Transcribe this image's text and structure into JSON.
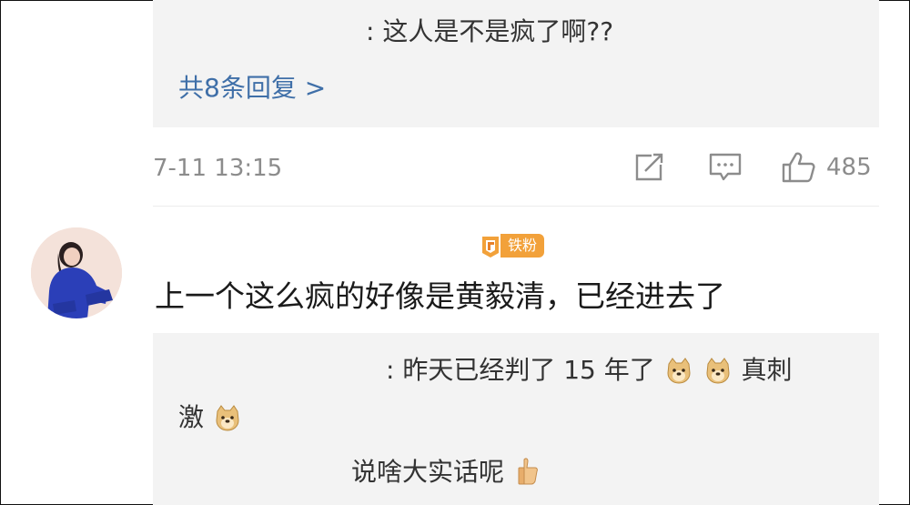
{
  "reply_box_1": {
    "reply_text": ": 这人是不是疯了啊??",
    "more_replies": "共8条回复 >"
  },
  "footer": {
    "timestamp": "7-11 13:15",
    "like_count": "485"
  },
  "comment": {
    "badge": "铁粉",
    "text": "上一个这么疯的好像是黄毅清，已经进去了"
  },
  "reply_box_2": {
    "reply1_text": ": 昨天已经判了 15 年了",
    "reply1_suffix": "真刺",
    "reply1_cont": "激",
    "reply2_text": "说啥大实话呢"
  },
  "colors": {
    "link": "#3f6fa8",
    "muted": "#8c8c8c",
    "reply_bg": "#f3f3f3",
    "badge": "#f2a13a"
  },
  "icons": [
    "share-icon",
    "comment-icon",
    "like-icon",
    "doge-emoji",
    "thumbs-up-emoji",
    "fan-badge-icon"
  ]
}
